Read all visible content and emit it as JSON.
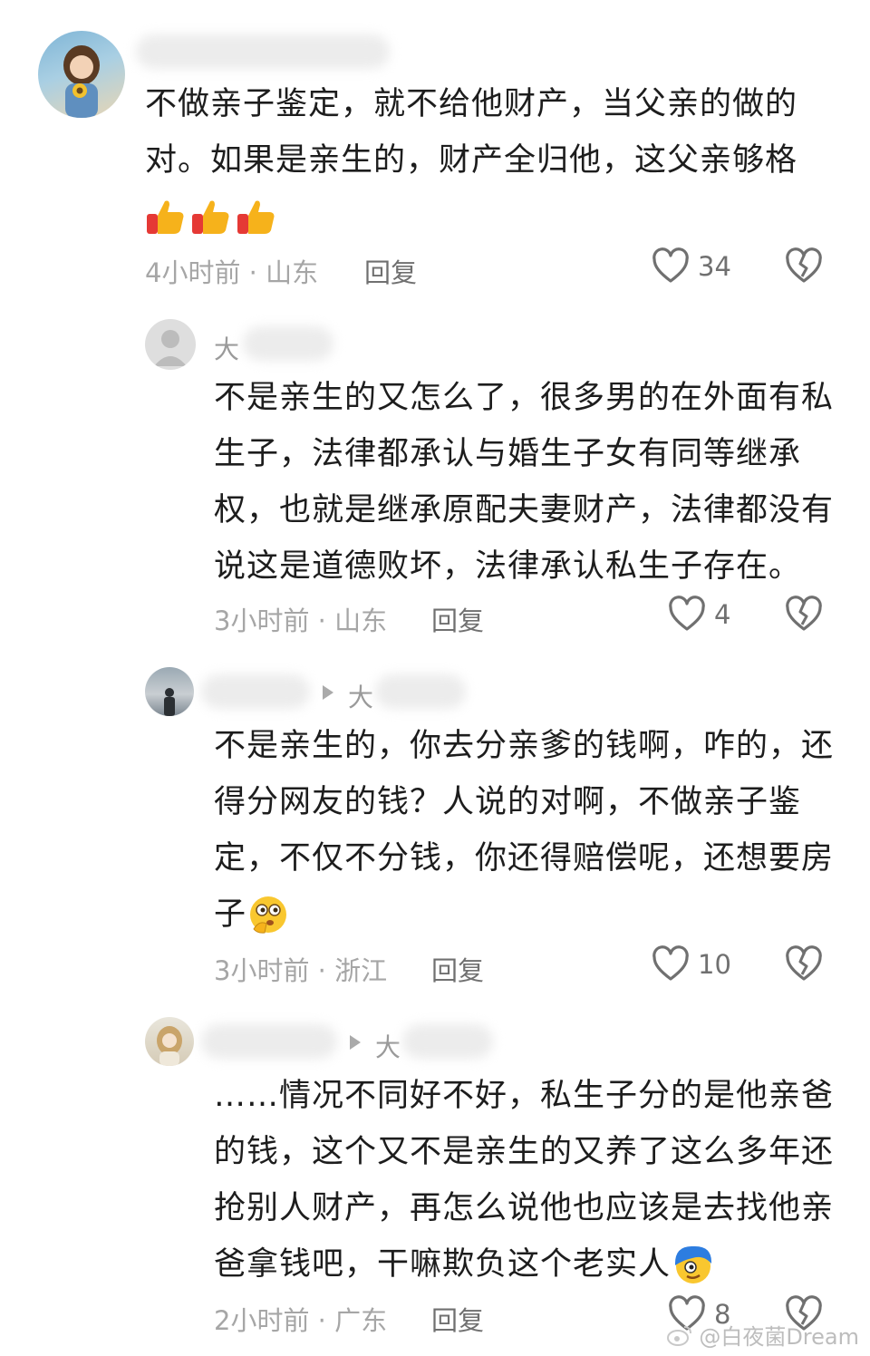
{
  "comments": [
    {
      "name_partial": "",
      "lines": [
        "不做亲子鉴定，就不给他财产，当父亲的做的",
        "对。如果是亲生的，财产全归他，这父亲够格"
      ],
      "emoji": "thumbs-up-emoji",
      "time_location": "4小时前 · 山东",
      "reply": "回复",
      "likes": "34"
    },
    {
      "name_partial": "大",
      "lines": [
        "不是亲生的又怎么了，很多男的在外面有私",
        "生子，法律都承认与婚生子女有同等继承",
        "权，也就是继承原配夫妻财产，法律都没有",
        "说这是道德败坏，法律承认私生子存在。"
      ],
      "time_location": "3小时前 · 山东",
      "reply": "回复",
      "likes": "4"
    },
    {
      "name_partial": "大",
      "lines": [
        "不是亲生的，你去分亲爹的钱啊，咋的，还",
        "得分网友的钱？人说的对啊，不做亲子鉴",
        "定，不仅不分钱，你还得赔偿呢，还想要房",
        "子"
      ],
      "emoji": "thinking-face-emoji",
      "time_location": "3小时前 · 浙江",
      "reply": "回复",
      "likes": "10"
    },
    {
      "name_partial": "大",
      "lines": [
        "……情况不同好不好，私生子分的是他亲爸",
        "的钱，这个又不是亲生的又养了这么多年还",
        "抢别人财产，再怎么说他也应该是去找他亲",
        "爸拿钱吧，干嘛欺负这个老实人"
      ],
      "emoji": "blue-hair-face-emoji",
      "time_location": "2小时前 · 广东",
      "reply": "回复",
      "likes": "8"
    }
  ],
  "icons": {
    "like": "heart-outline-icon",
    "dislike": "broken-heart-icon",
    "reply_arrow": "triangle-right-icon"
  },
  "watermark": "@白夜菌Dream",
  "colors": {
    "text": "#1d1d1d",
    "meta": "#a6a6a6",
    "icon": "#707070"
  }
}
